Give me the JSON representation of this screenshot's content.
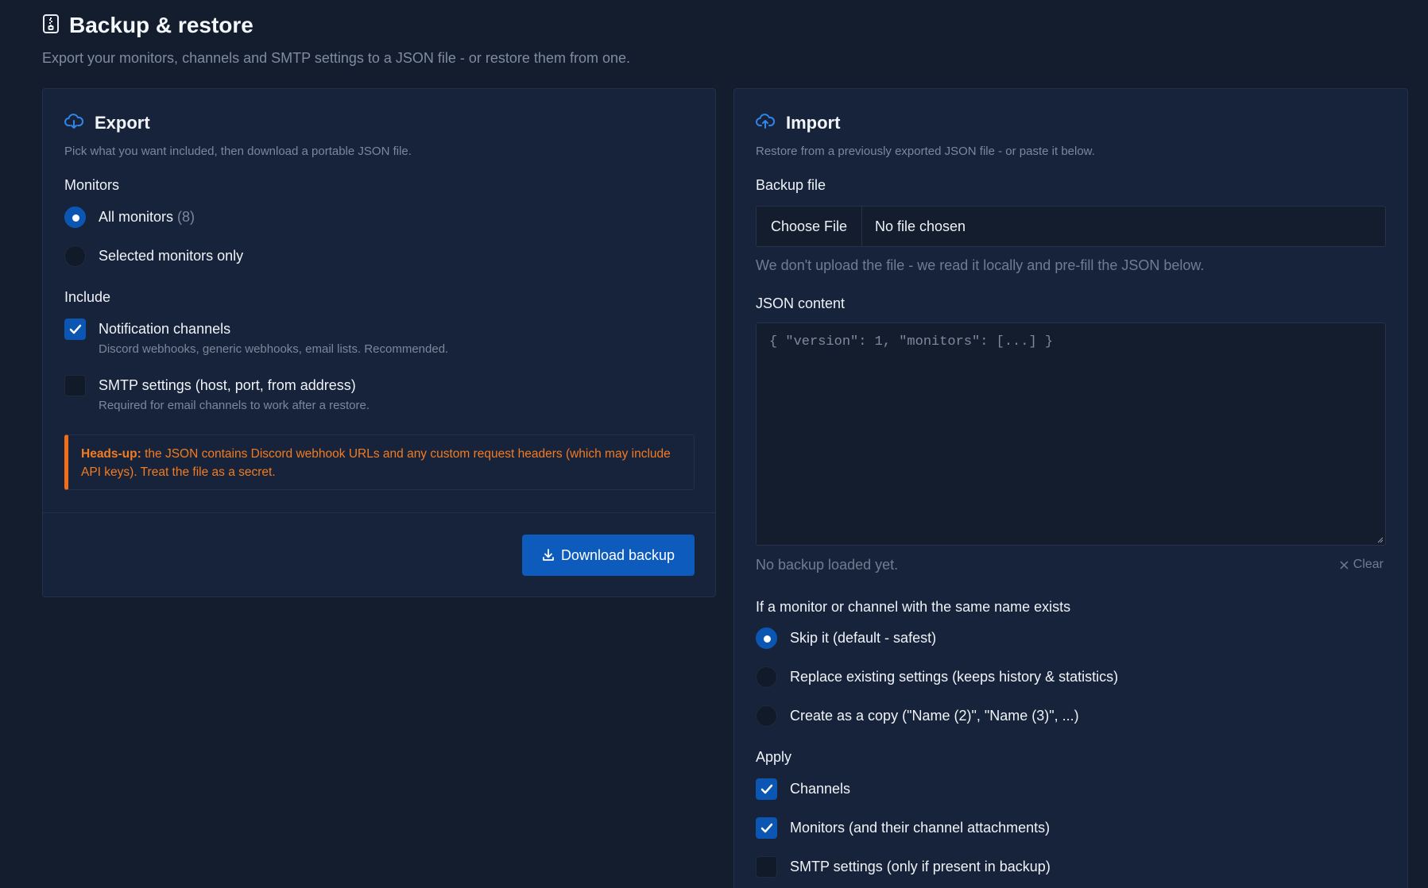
{
  "page": {
    "title": "Backup & restore",
    "subtitle": "Export your monitors, channels and SMTP settings to a JSON file - or restore them from one.",
    "title_icon": "archive-icon"
  },
  "export": {
    "title": "Export",
    "icon": "cloud-download-icon",
    "subtitle": "Pick what you want included, then download a portable JSON file.",
    "monitors_label": "Monitors",
    "monitor_options": [
      {
        "label": "All monitors",
        "count": "(8)",
        "selected": true
      },
      {
        "label": "Selected monitors only",
        "selected": false
      }
    ],
    "include_label": "Include",
    "include_options": [
      {
        "label": "Notification channels",
        "hint": "Discord webhooks, generic webhooks, email lists. Recommended.",
        "checked": true
      },
      {
        "label": "SMTP settings (host, port, from address)",
        "hint": "Required for email channels to work after a restore.",
        "checked": false
      }
    ],
    "warning_strong": "Heads-up:",
    "warning_text": " the JSON contains Discord webhook URLs and any custom request headers (which may include API keys). Treat the file as a secret.",
    "download_label": "Download backup"
  },
  "import": {
    "title": "Import",
    "icon": "cloud-upload-icon",
    "subtitle": "Restore from a previously exported JSON file - or paste it below.",
    "backup_file_label": "Backup file",
    "choose_file_label": "Choose File",
    "no_file_label": "No file chosen",
    "file_hint": "We don't upload the file - we read it locally and pre-fill the JSON below.",
    "json_label": "JSON content",
    "json_placeholder": "{ \"version\": 1, \"monitors\": [...] }",
    "status": "No backup loaded yet.",
    "clear_label": "Clear",
    "conflict_label": "If a monitor or channel with the same name exists",
    "conflict_options": [
      {
        "label": "Skip it (default - safest)",
        "selected": true
      },
      {
        "label": "Replace existing settings (keeps history & statistics)",
        "selected": false
      },
      {
        "label": "Create as a copy (\"Name (2)\", \"Name (3)\", ...)",
        "selected": false
      }
    ],
    "apply_label": "Apply",
    "apply_options": [
      {
        "label": "Channels",
        "checked": true
      },
      {
        "label": "Monitors (and their channel attachments)",
        "checked": true
      },
      {
        "label": "SMTP settings (only if present in backup)",
        "checked": false
      }
    ]
  },
  "colors": {
    "background": "#131d2d",
    "card": "#17233a",
    "accent": "#0c5bbd",
    "warning": "#f37b20"
  }
}
